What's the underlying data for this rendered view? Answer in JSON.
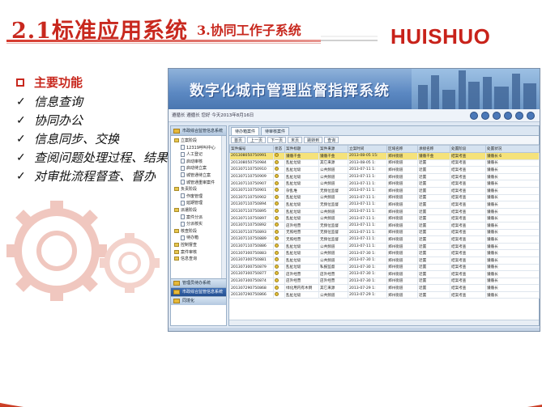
{
  "slide": {
    "title_main": "2.1标准应用系统",
    "title_sub": "3.协同工作子系统",
    "logo": "HUISHUO"
  },
  "bullets": [
    {
      "text": "主要功能",
      "style": "red"
    },
    {
      "text": "信息查询",
      "style": "check"
    },
    {
      "text": "协同办公",
      "style": "check"
    },
    {
      "text": "信息同步、交换",
      "style": "check"
    },
    {
      "text": "查阅问题处理过程、结果",
      "style": "check"
    },
    {
      "text": "对审批流程督查、督办",
      "style": "check"
    }
  ],
  "app": {
    "title": "数字化城市管理监督指挥系统",
    "info_bar": "遵循长 遵循长 您好 今天2013年8月16日",
    "sidebar_header": "市政综合监管信息系统",
    "tree": [
      "立案阶段",
      "12319呼叫中心",
      "人工登记",
      "启动审核",
      "启动待立案",
      "城管通待立案",
      "城管通重审案件",
      "负责阶段",
      "作废管理",
      "延期管理",
      "派遣阶段",
      "案件分派",
      "分派核实",
      "核查阶段",
      "待办箱",
      "控制督查",
      "案件审核",
      "信息查询"
    ],
    "sidebar_sections": [
      {
        "label": "管理员待办系统",
        "active": false
      },
      {
        "label": "市政综合监管信息系统",
        "active": true
      },
      {
        "label": "同境化",
        "active": false
      }
    ],
    "tabs": [
      "待办箱案件",
      "待审核案件"
    ],
    "toolbar": [
      "首页",
      "上一页",
      "下一页",
      "末页",
      "跳转到",
      "查询"
    ],
    "columns": [
      "案件编号",
      "状态",
      "案件标题",
      "案件来源",
      "立案时间",
      "区域名称",
      "承接名称",
      "处置阶段",
      "处置状况"
    ],
    "rows": [
      [
        "201308050750991",
        "",
        "遵循千金",
        "遵循千金",
        "2013-08-05 15:",
        "郑州街道",
        "遵循千金",
        "结案考查",
        "遵循长 6"
      ],
      [
        "201308050750984",
        "",
        "乱扯垃圾",
        "其它来源",
        "2013-08-05 1:",
        "郑州街道",
        "近置",
        "结案考查",
        "遵循长"
      ],
      [
        "201307110750910",
        "",
        "乱扯垃圾",
        "公共频道",
        "2013-07-11 1:",
        "郑州街道",
        "近置",
        "结案考查",
        "遵循长"
      ],
      [
        "201307110750909",
        "",
        "乱扯垃圾",
        "公共频道",
        "2013-07-11 1:",
        "郑州街道",
        "近置",
        "结案考查",
        "遵循长"
      ],
      [
        "201307110750907",
        "",
        "乱扯垃圾",
        "公共频道",
        "2013-07-11 1:",
        "郑州街道",
        "近置",
        "结案考查",
        "遵循长"
      ],
      [
        "201307110750901",
        "",
        "杂乱堆",
        "无频位监督",
        "2013-07-11 1:",
        "郑州街道",
        "近置",
        "结案考查",
        "遵循长"
      ],
      [
        "201307110750902",
        "",
        "乱扯垃圾",
        "公共频道",
        "2013-07-11 1:",
        "郑州街道",
        "近置",
        "结案考查",
        "遵循长"
      ],
      [
        "201307110750894",
        "",
        "乱扯垃圾",
        "无频位监督",
        "2013-07-11 1:",
        "郑州街道",
        "近置",
        "结案考查",
        "遵循长"
      ],
      [
        "201307110750895",
        "",
        "乱扯垃圾",
        "公共频道",
        "2013-07-11 1:",
        "郑州街道",
        "近置",
        "结案考查",
        "遵循长"
      ],
      [
        "201307110750897",
        "",
        "乱扯垃圾",
        "公共频道",
        "2013-07-11 1:",
        "郑州街道",
        "近置",
        "结案考查",
        "遵循长"
      ],
      [
        "201307110750892",
        "",
        "店外经营",
        "无频位监督",
        "2013-07-11 1:",
        "郑州街道",
        "近置",
        "结案考查",
        "遵循长"
      ],
      [
        "201307110750893",
        "",
        "无照经营",
        "无频位监督",
        "2013-07-11 1:",
        "郑州街道",
        "近置",
        "结案考查",
        "遵循长"
      ],
      [
        "201307110750889",
        "",
        "无照经营",
        "无频位监督",
        "2013-07-11 1:",
        "郑州街道",
        "近置",
        "结案考查",
        "遵循长"
      ],
      [
        "201307110750886",
        "",
        "乱扯垃圾",
        "公共频道",
        "2013-07-11 1:",
        "郑州街道",
        "近置",
        "结案考查",
        "遵循长"
      ],
      [
        "201307300750883",
        "",
        "乱扯垃圾",
        "公共频道",
        "2013-07-30 1:",
        "郑州街道",
        "近置",
        "结案考查",
        "遵循长"
      ],
      [
        "201307300750881",
        "",
        "乱扯垃圾",
        "公共频道",
        "2013-07-30 1:",
        "郑州街道",
        "近置",
        "结案考查",
        "遵循长"
      ],
      [
        "201307300750879",
        "",
        "乱扯垃圾",
        "私报监督",
        "2013-07-30 1:",
        "郑州街道",
        "近置",
        "结案考查",
        "遵循长"
      ],
      [
        "201307300750877",
        "",
        "店外经营",
        "店外经营",
        "2013-07-30 1:",
        "郑州街道",
        "近置",
        "结案考查",
        "遵循长"
      ],
      [
        "201307300750874",
        "",
        "店外经营",
        "店外经营",
        "2013-07-30 1:",
        "郑州街道",
        "近置",
        "结案考查",
        "遵循长"
      ],
      [
        "201307290750868",
        "",
        "绿化用内有木倒",
        "其它来源",
        "2013-07-29 1:",
        "郑州街道",
        "近置",
        "结案考查",
        "遵循长"
      ],
      [
        "201307290750866",
        "",
        "乱扯垃圾",
        "公共频道",
        "2013-07-29 1:",
        "郑州街道",
        "近置",
        "结案考查",
        "遵循长"
      ]
    ]
  },
  "colors": {
    "accent": "#c8281e",
    "app_blue": "#4a76b0"
  }
}
